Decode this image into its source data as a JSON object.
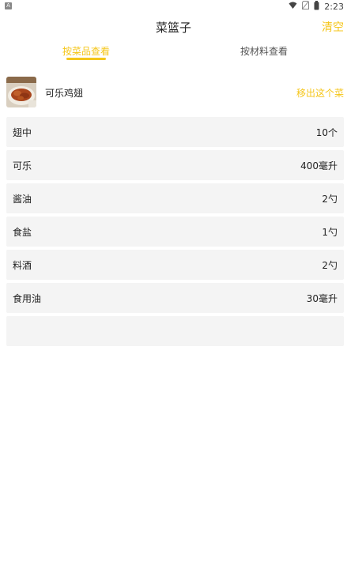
{
  "status_bar": {
    "left_badge": "A",
    "time": "2:23",
    "icons": [
      "wifi-icon",
      "no-sim-icon",
      "battery-icon"
    ]
  },
  "header": {
    "title": "菜篮子",
    "clear_label": "清空"
  },
  "tabs": [
    {
      "label": "按菜品查看",
      "active": true
    },
    {
      "label": "按材料查看",
      "active": false
    }
  ],
  "dish": {
    "name": "可乐鸡翅",
    "remove_label": "移出这个菜"
  },
  "ingredients": [
    {
      "name": "翅中",
      "qty": "10个"
    },
    {
      "name": "可乐",
      "qty": "400毫升"
    },
    {
      "name": "酱油",
      "qty": "2勺"
    },
    {
      "name": "食盐",
      "qty": "1勺"
    },
    {
      "name": "料酒",
      "qty": "2勺"
    },
    {
      "name": "食用油",
      "qty": "30毫升"
    }
  ],
  "colors": {
    "accent": "#f5c61a",
    "row_bg": "#f4f4f4"
  }
}
